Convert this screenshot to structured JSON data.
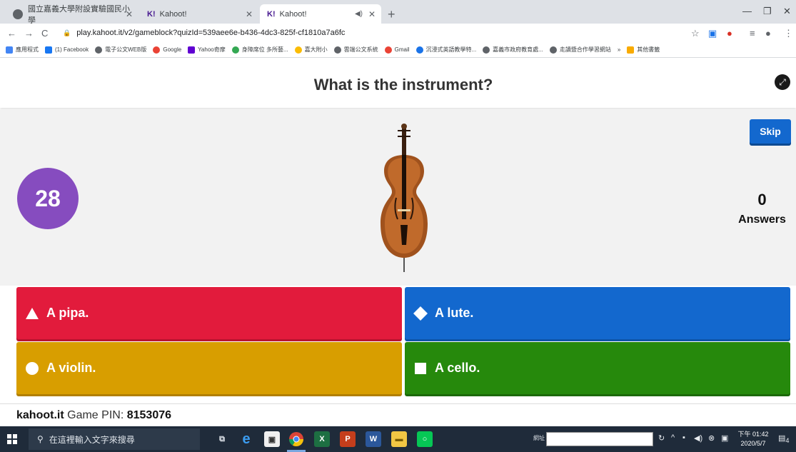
{
  "browser": {
    "tabs": [
      {
        "title": "國立嘉義大學附設實驗國民小學"
      },
      {
        "title": "Kahoot!"
      },
      {
        "title": "Kahoot!"
      }
    ],
    "url": "play.kahoot.it/v2/gameblock?quizId=539aee6e-b436-4dc3-825f-cf1810a7a6fc",
    "bookmarks": [
      "應用程式",
      "(1) Facebook",
      "電子公文WEB版",
      "Google",
      "Yahoo奇摩",
      "身障席位 多所藝...",
      "嘉大附小",
      "雲端公文系統",
      "Gmail",
      "沉浸式英語教學特...",
      "嘉義市政府教育處...",
      "走讀暨合作學習網站",
      "»",
      "其他書籤"
    ]
  },
  "game": {
    "question": "What is the instrument?",
    "timer": "28",
    "skip_label": "Skip",
    "answers_count": "0",
    "answers_label": "Answers",
    "image_icon": "cello-image",
    "options": [
      {
        "text": "A pipa.",
        "shape": "triangle-icon",
        "color": "#e21b3c"
      },
      {
        "text": "A lute.",
        "shape": "diamond-icon",
        "color": "#1368ce"
      },
      {
        "text": "A violin.",
        "shape": "circle-icon",
        "color": "#d89e00"
      },
      {
        "text": "A cello.",
        "shape": "square-icon",
        "color": "#26890c"
      }
    ],
    "footer_site": "kahoot.it",
    "footer_pin_label": "Game PIN:",
    "footer_pin": "8153076"
  },
  "taskbar": {
    "search_placeholder": "在這裡輸入文字來搜尋",
    "network_label": "網址",
    "clock_time": "下午 01:42",
    "clock_date": "2020/5/7",
    "notification_count": "4"
  }
}
